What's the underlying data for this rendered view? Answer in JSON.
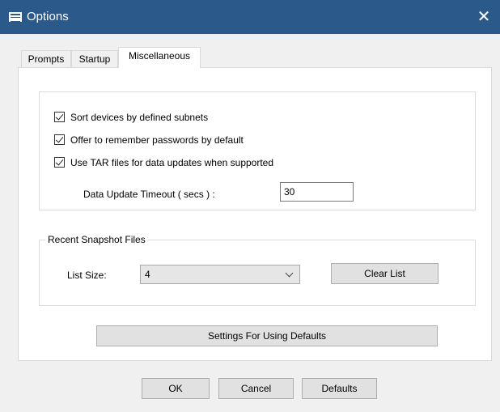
{
  "window": {
    "title": "Options",
    "close_glyph": "✕"
  },
  "tabs": [
    {
      "label": "Prompts",
      "active": false
    },
    {
      "label": "Startup",
      "active": false
    },
    {
      "label": "Miscellaneous",
      "active": true
    }
  ],
  "misc": {
    "checkboxes": [
      {
        "label": "Sort devices by defined subnets",
        "checked": true
      },
      {
        "label": "Offer to remember passwords by default",
        "checked": true
      },
      {
        "label": "Use TAR files for data updates when supported",
        "checked": true
      }
    ],
    "timeout_label": "Data Update Timeout ( secs ) :",
    "timeout_value": "30",
    "recent_group_label": "Recent Snapshot Files",
    "list_size_label": "List Size:",
    "list_size_value": "4",
    "clear_list_label": "Clear List",
    "settings_defaults_label": "Settings For Using Defaults"
  },
  "footer": {
    "ok_label": "OK",
    "cancel_label": "Cancel",
    "defaults_label": "Defaults"
  },
  "colors": {
    "titlebar": "#2b5a8a",
    "window_bg": "#f0f0f0",
    "panel_bg": "#ffffff",
    "button_bg": "#e1e1e1"
  },
  "icons": {
    "title": "options-window-icon",
    "close": "close-icon",
    "dropdown": "chevron-down-icon",
    "check": "check-icon"
  }
}
